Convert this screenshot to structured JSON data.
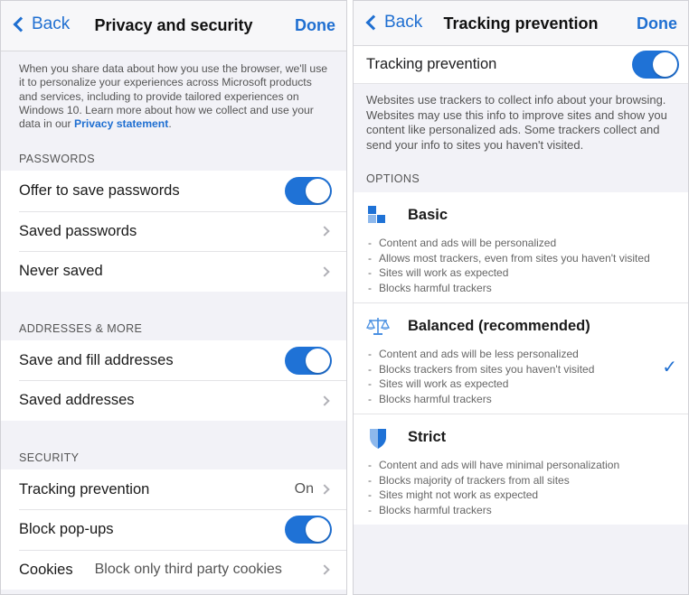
{
  "left": {
    "nav": {
      "back": "Back",
      "title": "Privacy and security",
      "done": "Done"
    },
    "intro": {
      "text": "When you share data about how you use the browser, we'll use it to personalize your experiences across Microsoft products and services, including to provide tailored experiences on Windows 10. Learn more about how we collect and use your data in our ",
      "link": "Privacy statement",
      "end": "."
    },
    "sections": [
      {
        "header": "PASSWORDS",
        "rows": [
          {
            "label": "Offer to save passwords",
            "toggle": true
          },
          {
            "label": "Saved passwords"
          },
          {
            "label": "Never saved"
          }
        ]
      },
      {
        "header": "ADDRESSES & MORE",
        "rows": [
          {
            "label": "Save and fill addresses",
            "toggle": true
          },
          {
            "label": "Saved addresses"
          }
        ]
      },
      {
        "header": "SECURITY",
        "rows": [
          {
            "label": "Tracking prevention",
            "value": "On"
          },
          {
            "label": "Block pop-ups",
            "toggle": true
          },
          {
            "label": "Cookies",
            "value": "Block only third party cookies"
          }
        ]
      }
    ]
  },
  "right": {
    "nav": {
      "back": "Back",
      "title": "Tracking prevention",
      "done": "Done"
    },
    "master": {
      "label": "Tracking prevention",
      "toggle": true
    },
    "description": "Websites use trackers to collect info about your browsing. Websites may use this info to improve sites and show you content like personalized ads. Some trackers collect and send your info to sites you haven't visited.",
    "options_header": "OPTIONS",
    "options": [
      {
        "title": "Basic",
        "icon": "basic-icon",
        "selected": false,
        "items": [
          "Content and ads will be personalized",
          "Allows most trackers, even from sites you haven't visited",
          "Sites will work as expected",
          "Blocks harmful trackers"
        ]
      },
      {
        "title": "Balanced (recommended)",
        "icon": "scale-icon",
        "selected": true,
        "items": [
          "Content and ads will be less personalized",
          "Blocks trackers from sites you haven't visited",
          "Sites will work as expected",
          "Blocks harmful trackers"
        ]
      },
      {
        "title": "Strict",
        "icon": "shield-icon",
        "selected": false,
        "items": [
          "Content and ads will have minimal personalization",
          "Blocks majority of trackers from all sites",
          "Sites might not work as expected",
          "Blocks harmful trackers"
        ]
      }
    ]
  },
  "colors": {
    "accent": "#1f72d6",
    "link": "#1f6fd1",
    "background": "#f2f2f7"
  }
}
